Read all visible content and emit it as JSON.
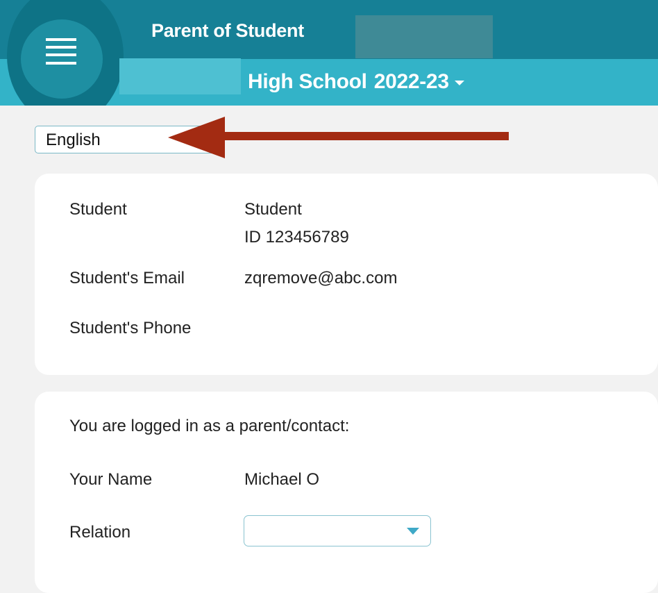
{
  "header": {
    "title": "Parent of Student",
    "school_suffix": "High School",
    "year": "2022-23"
  },
  "language": {
    "selected": "English"
  },
  "student_card": {
    "student_label": "Student",
    "student_name": "Student",
    "student_id": "ID 123456789",
    "email_label": "Student's Email",
    "email_value": "zqremove@abc.com",
    "phone_label": "Student's Phone"
  },
  "parent_card": {
    "intro": "You are logged in as a parent/contact:",
    "name_label": "Your Name",
    "name_value": "Michael O",
    "relation_label": "Relation",
    "relation_value": ""
  },
  "colors": {
    "header_dark": "#168096",
    "header_light": "#33b3c8",
    "arrow": "#a32b12",
    "background": "#f2f2f2"
  }
}
